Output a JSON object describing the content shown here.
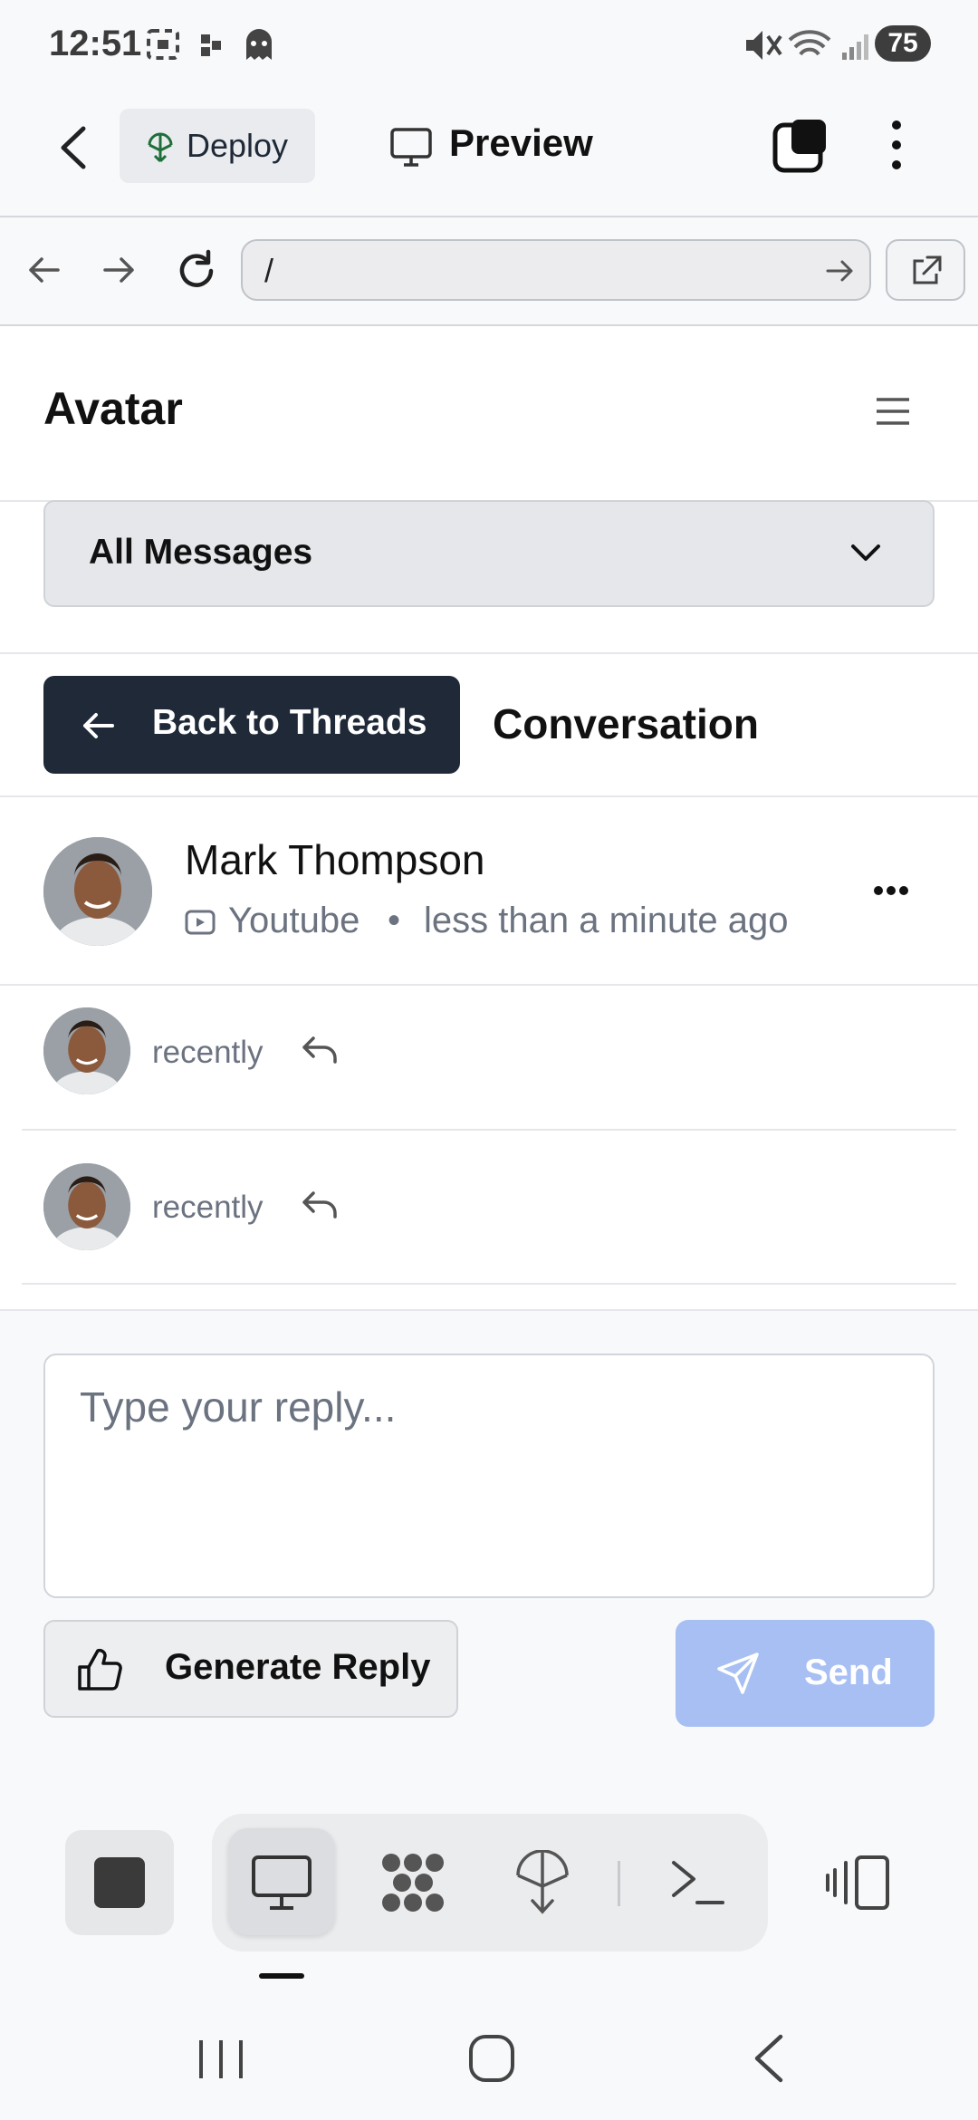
{
  "status_bar": {
    "time": "12:51",
    "battery": "75"
  },
  "top_bar": {
    "deploy_label": "Deploy",
    "preview_label": "Preview"
  },
  "url_bar": {
    "url": "/"
  },
  "app": {
    "title": "Avatar",
    "filter": {
      "selected": "All Messages"
    },
    "back_label": "Back to Threads",
    "section_title": "Conversation",
    "thread": {
      "name": "Mark Thompson",
      "source": "Youtube",
      "separator": "•",
      "time": "less than a minute ago"
    },
    "messages": [
      {
        "time": "recently"
      },
      {
        "time": "recently"
      }
    ],
    "reply": {
      "placeholder": "Type your reply...",
      "generate_label": "Generate Reply",
      "send_label": "Send"
    }
  },
  "colors": {
    "primary_dark": "#1f2937",
    "send_disabled": "#a7bff3"
  }
}
